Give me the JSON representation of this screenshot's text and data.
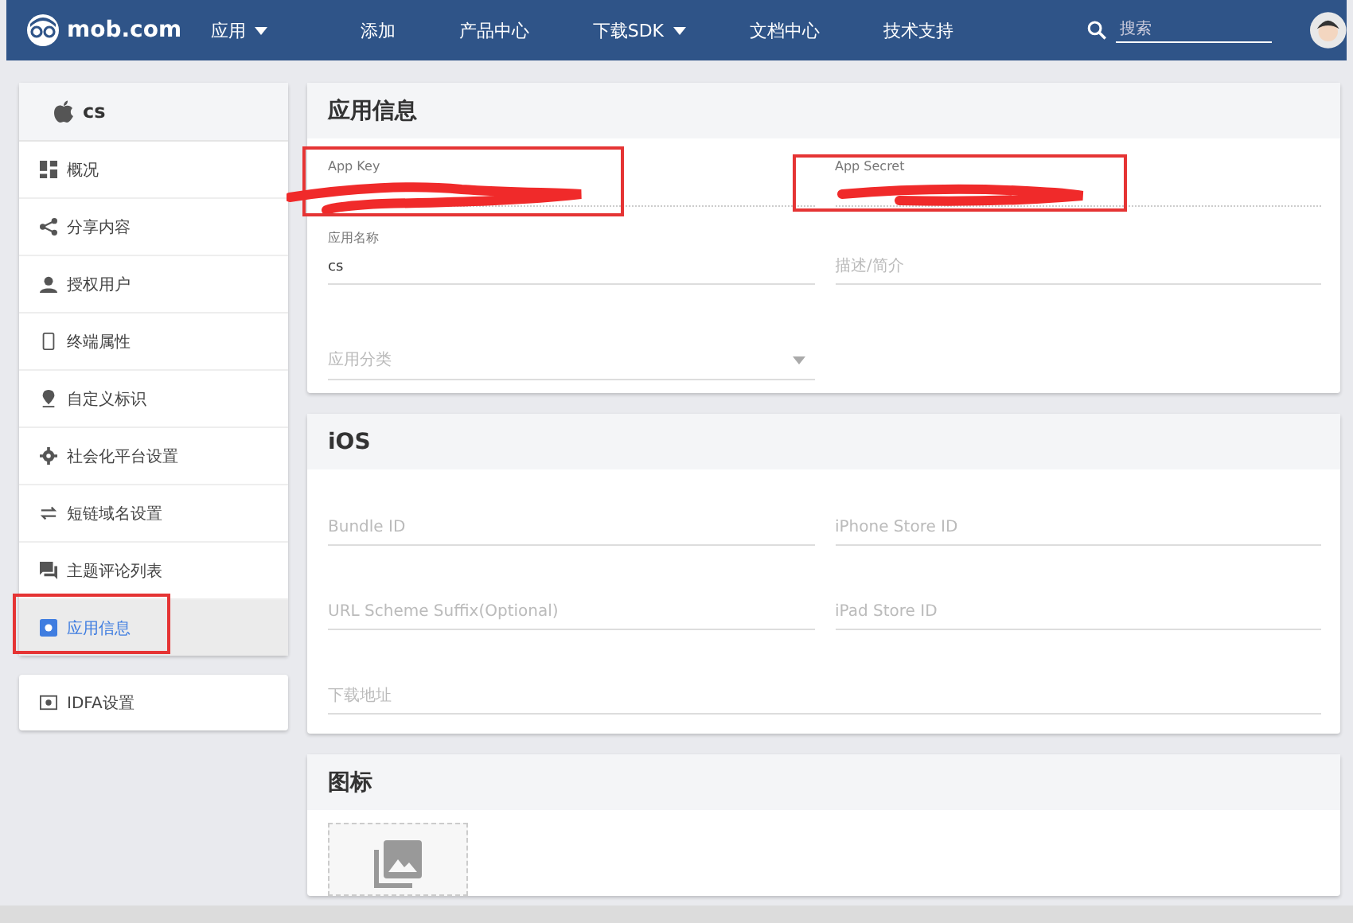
{
  "navbar": {
    "logo": "mob.com",
    "items": [
      {
        "label": "应用",
        "dropdown": true
      },
      {
        "label": "添加",
        "dropdown": false
      },
      {
        "label": "产品中心",
        "dropdown": false
      },
      {
        "label": "下载SDK",
        "dropdown": true
      },
      {
        "label": "文档中心",
        "dropdown": false
      },
      {
        "label": "技术支持",
        "dropdown": false
      }
    ],
    "search": {
      "placeholder": "搜索"
    }
  },
  "sidebar": {
    "app_name": "cs",
    "items": [
      {
        "label": "概况",
        "selected": false
      },
      {
        "label": "分享内容",
        "selected": false
      },
      {
        "label": "授权用户",
        "selected": false
      },
      {
        "label": "终端属性",
        "selected": false
      },
      {
        "label": "自定义标识",
        "selected": false
      },
      {
        "label": "社会化平台设置",
        "selected": false
      },
      {
        "label": "短链域名设置",
        "selected": false
      },
      {
        "label": "主题评论列表",
        "selected": false
      },
      {
        "label": "应用信息",
        "selected": true
      }
    ],
    "extra_item": {
      "label": "IDFA设置",
      "selected": false
    }
  },
  "app_info": {
    "title": "应用信息",
    "fields": [
      {
        "kind": "redacted",
        "label": "App Key"
      },
      {
        "kind": "redacted",
        "label": "App Secret"
      },
      {
        "kind": "text",
        "label": "应用名称",
        "value": "cs"
      },
      {
        "kind": "empty",
        "placeholder": "描述/简介"
      },
      {
        "kind": "select",
        "placeholder": "应用分类"
      }
    ]
  },
  "ios": {
    "title": "iOS",
    "fields": [
      {
        "placeholder": "Bundle ID",
        "full": false
      },
      {
        "placeholder": "iPhone Store ID",
        "full": false
      },
      {
        "placeholder": "URL Scheme Suffix(Optional)",
        "full": false
      },
      {
        "placeholder": "iPad Store ID",
        "full": false
      },
      {
        "placeholder": "下载地址",
        "full": true
      }
    ]
  },
  "icon_section": {
    "title": "图标"
  }
}
